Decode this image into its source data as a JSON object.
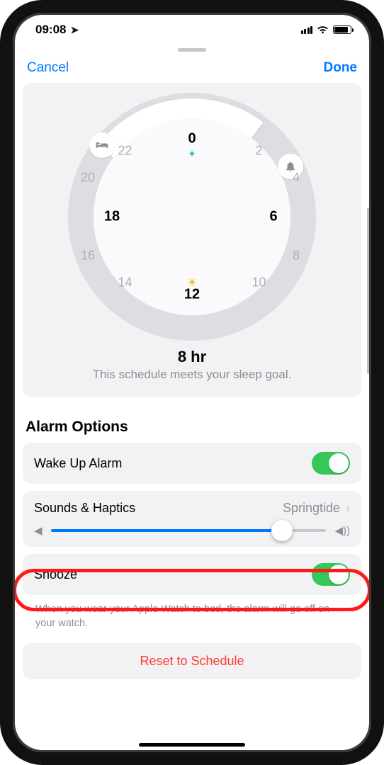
{
  "status": {
    "time": "09:08"
  },
  "header": {
    "cancel": "Cancel",
    "done": "Done"
  },
  "clock": {
    "hours": [
      "0",
      "2",
      "4",
      "6",
      "8",
      "10",
      "12",
      "14",
      "16",
      "18",
      "20",
      "22"
    ],
    "main_hours": [
      "0",
      "6",
      "12",
      "18"
    ],
    "duration": "8 hr",
    "subtitle": "This schedule meets your sleep goal."
  },
  "section_title": "Alarm Options",
  "rows": {
    "wake": {
      "label": "Wake Up Alarm",
      "on": true
    },
    "sounds": {
      "label": "Sounds & Haptics",
      "value": "Springtide"
    },
    "volume_percent": 84,
    "snooze": {
      "label": "Snooze",
      "on": true
    }
  },
  "footer": "When you wear your Apple Watch to bed, the alarm will go off on your watch.",
  "reset": "Reset to Schedule",
  "colors": {
    "accent": "#007aff",
    "green": "#34c759",
    "red": "#ff3b30"
  }
}
